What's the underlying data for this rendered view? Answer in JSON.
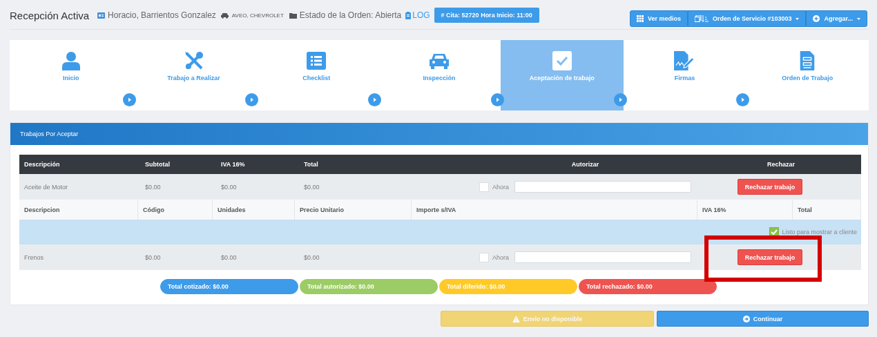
{
  "header": {
    "title": "Recepción Activa",
    "customer": "Horacio, Barrientos Gonzalez",
    "vehicle": "AVEO, CHEVROLET",
    "status": "Estado de la Orden: Abierta",
    "log": "LOG",
    "appointment": "# Cita: 52720 Hora Inicio: 11:00",
    "actions": [
      {
        "kind": "grid",
        "label": "Ver medios",
        "dropdown": false
      },
      {
        "kind": "order",
        "label": "Orden de Servicio #103003",
        "dropdown": true
      },
      {
        "kind": "plus",
        "label": "Agregar...",
        "dropdown": true
      }
    ]
  },
  "steps": [
    {
      "label": "Inicio",
      "selected": false
    },
    {
      "label": "Trabajo a Realizar",
      "selected": false
    },
    {
      "label": "Checklist",
      "selected": false
    },
    {
      "label": "Inspección",
      "selected": false
    },
    {
      "label": "Aceptación de trabajo",
      "selected": true
    },
    {
      "label": "Firmas",
      "selected": false
    },
    {
      "label": "Orden de Trabajo",
      "selected": false
    }
  ],
  "panel": {
    "title": "Trabajos Por Aceptar",
    "columns": [
      "Descripción",
      "Subtotal",
      "IVA 16%",
      "Total",
      "Autorizar",
      "Rechazar"
    ],
    "jobs": [
      {
        "description": "Aceite de Motor",
        "subtotal": "$0.00",
        "iva": "$0.00",
        "total": "$0.00",
        "now_label": "Ahora",
        "now_checked": false,
        "reject": "Rechazar trabajo",
        "highlighted": false,
        "detail": {
          "columns": [
            "Descripcion",
            "Código",
            "Unidades",
            "Precio Unitario",
            "Importe s/IVA",
            "IVA 16%",
            "Total"
          ],
          "ready_label": "Listo para mostrar a cliente",
          "ready_checked": true
        }
      },
      {
        "description": "Frenos",
        "subtotal": "$0.00",
        "iva": "$0.00",
        "total": "$0.00",
        "now_label": "Ahora",
        "now_checked": false,
        "reject": "Rechazar trabajo",
        "highlighted": true
      }
    ],
    "totals": [
      {
        "label": "Total cotizado: $0.00",
        "color": "#3d9be9"
      },
      {
        "label": "Total autorizado: $0.00",
        "color": "#9ccc65"
      },
      {
        "label": "Total diferido: $0.00",
        "color": "#ffca28"
      },
      {
        "label": "Total rechazado: $0.00",
        "color": "#ef5350"
      }
    ]
  },
  "footer": [
    {
      "kind": "warning",
      "label": "Envío no disponible",
      "disabled": true
    },
    {
      "kind": "continue",
      "label": "Continuar",
      "disabled": false
    }
  ]
}
